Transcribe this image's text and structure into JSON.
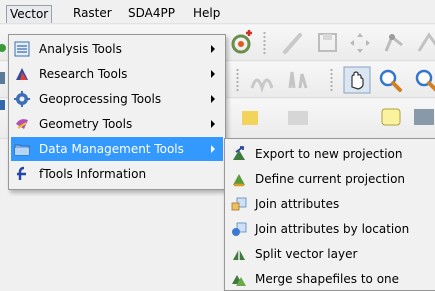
{
  "menubar": {
    "items": [
      {
        "label": "Vector"
      },
      {
        "label": "Raster"
      },
      {
        "label": "SDA4PP"
      },
      {
        "label": "Help"
      }
    ]
  },
  "vector_menu": {
    "items": [
      {
        "label": "Analysis Tools",
        "icon": "analysis-tools-icon"
      },
      {
        "label": "Research Tools",
        "icon": "research-tools-icon"
      },
      {
        "label": "Geoprocessing Tools",
        "icon": "geoprocessing-gear-icon"
      },
      {
        "label": "Geometry Tools",
        "icon": "geometry-tools-icon"
      },
      {
        "label": "Data Management Tools",
        "icon": "data-management-folder-icon",
        "highlighted": true
      },
      {
        "label": "fTools Information",
        "icon": "ftools-info-icon"
      }
    ]
  },
  "data_management_submenu": {
    "items": [
      {
        "label": "Export to new projection",
        "icon": "export-projection-icon"
      },
      {
        "label": "Define current projection",
        "icon": "define-projection-icon"
      },
      {
        "label": "Join attributes",
        "icon": "join-attributes-icon"
      },
      {
        "label": "Join attributes by location",
        "icon": "join-by-location-icon"
      },
      {
        "label": "Split vector layer",
        "icon": "split-layer-icon"
      },
      {
        "label": "Merge shapefiles to one",
        "icon": "merge-shapefiles-icon"
      }
    ]
  },
  "colors": {
    "highlight": "#3399ff",
    "menu_background": "#f1f1f1",
    "menubar_background": "#f0f0f0"
  }
}
